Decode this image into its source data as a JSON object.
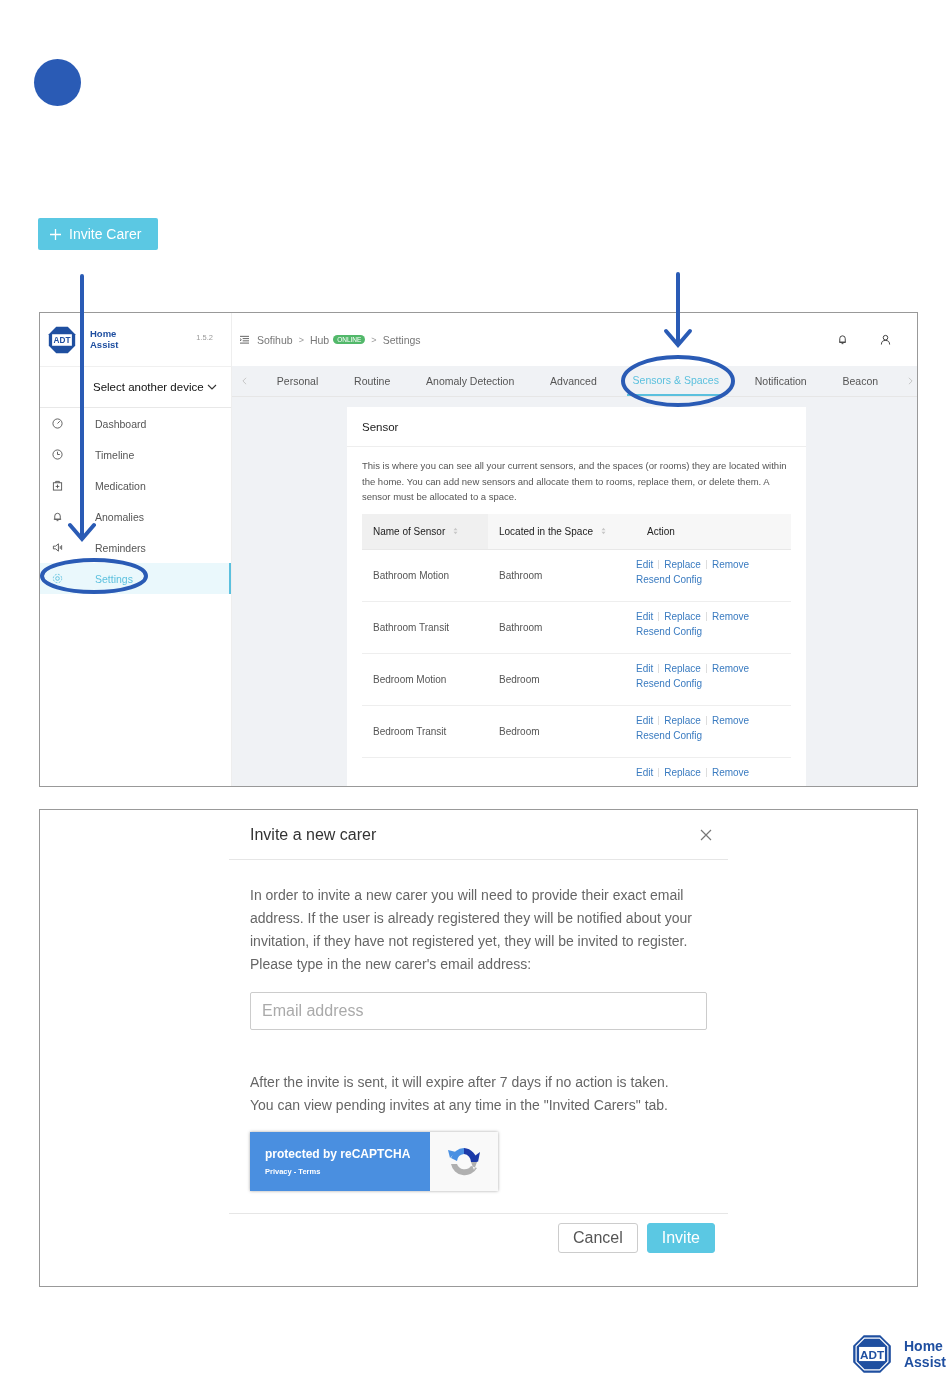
{
  "invite_button": {
    "label": "Invite Carer"
  },
  "app_screenshot": {
    "logo": {
      "badge": "ADT",
      "line1": "Home",
      "line2": "Assist",
      "version": "1.5.2"
    },
    "device_select": "Select another device",
    "sidebar": [
      {
        "label": "Dashboard",
        "kind": "gauge",
        "selected": false
      },
      {
        "label": "Timeline",
        "kind": "clock",
        "selected": false
      },
      {
        "label": "Medication",
        "kind": "medkit",
        "selected": false
      },
      {
        "label": "Anomalies",
        "kind": "bell",
        "selected": false
      },
      {
        "label": "Reminders",
        "kind": "speaker",
        "selected": false
      },
      {
        "label": "Settings",
        "kind": "gear",
        "selected": true
      }
    ],
    "breadcrumb_separator": ">",
    "breadcrumb": [
      {
        "label": "Sofihub"
      },
      {
        "label": "Hub",
        "badge": "ONLINE"
      },
      {
        "label": "Settings"
      }
    ],
    "tabs": [
      {
        "label": "Personal",
        "selected": false
      },
      {
        "label": "Routine",
        "selected": false
      },
      {
        "label": "Anomaly Detection",
        "selected": false
      },
      {
        "label": "Advanced",
        "selected": false
      },
      {
        "label": "Sensors & Spaces",
        "selected": true
      },
      {
        "label": "Notification",
        "selected": false
      },
      {
        "label": "Beacon",
        "selected": false
      }
    ],
    "card": {
      "title": "Sensor",
      "description": "This is where you can see all your current sensors, and the spaces (or rooms) they are located within the home. You can add new sensors and allocate them to rooms, replace them, or delete them. A sensor must be allocated to a space.",
      "columns": [
        {
          "label": "Name of Sensor",
          "sortable": true
        },
        {
          "label": "Located in the Space",
          "sortable": true
        },
        {
          "label": "Action",
          "sortable": false
        }
      ],
      "rows": [
        {
          "name": "Bathroom Motion",
          "space": "Bathroom",
          "actions": [
            "Edit",
            "Replace",
            "Remove",
            "Resend Config"
          ]
        },
        {
          "name": "Bathroom Transit",
          "space": "Bathroom",
          "actions": [
            "Edit",
            "Replace",
            "Remove",
            "Resend Config"
          ]
        },
        {
          "name": "Bedroom Motion",
          "space": "Bedroom",
          "actions": [
            "Edit",
            "Replace",
            "Remove",
            "Resend Config"
          ]
        },
        {
          "name": "Bedroom Transit",
          "space": "Bedroom",
          "actions": [
            "Edit",
            "Replace",
            "Remove",
            "Resend Config"
          ]
        },
        {
          "actions": [
            "Edit",
            "Replace",
            "Remove"
          ]
        }
      ]
    }
  },
  "dialog": {
    "title": "Invite a new carer",
    "text": "In order to invite a new carer you will need to provide their exact email address. If the user is already registered they will be notified about your invitation, if they have not registered yet, they will be invited to register. Please type in the new carer's email address:",
    "email": {
      "placeholder": "Email address"
    },
    "note": "After the invite is sent, it will expire after 7 days if no action is taken. You can view pending invites at any time in the \"Invited Carers\" tab.",
    "recaptcha": {
      "title": "protected by reCAPTCHA",
      "links": "Privacy - Terms"
    },
    "buttons": [
      {
        "label": "Cancel",
        "kind": "secondary"
      },
      {
        "label": "Invite",
        "kind": "primary"
      }
    ]
  },
  "footer_logo": {
    "badge": "ADT",
    "line1": "Home",
    "line2": "Assist"
  }
}
